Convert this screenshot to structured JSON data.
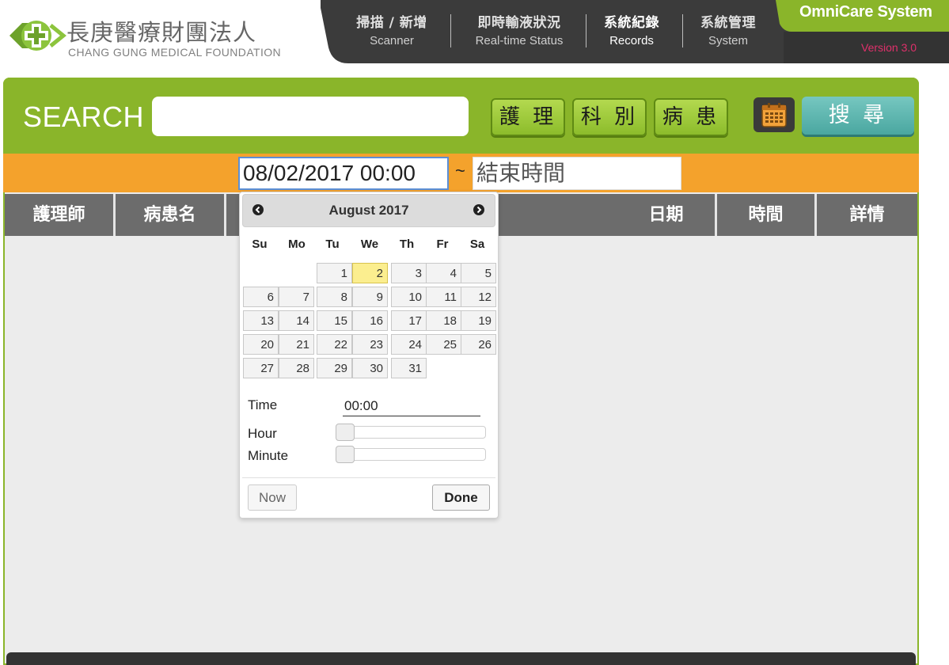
{
  "header": {
    "org_name_zh": "長庚醫療財團法人",
    "org_name_en": "CHANG GUNG MEDICAL FOUNDATION",
    "brand": "OmniCare System",
    "version": "Version 3.0",
    "nav": [
      {
        "zh": "掃描 / 新增",
        "en": "Scanner"
      },
      {
        "zh": "即時輸液狀況",
        "en": "Real-time Status"
      },
      {
        "zh": "系統紀錄",
        "en": "Records"
      },
      {
        "zh": "系統管理",
        "en": "System"
      }
    ],
    "active_nav": "Records"
  },
  "search": {
    "label": "SEARCH",
    "value": "",
    "filters": [
      "護 理",
      "科 別",
      "病 患"
    ],
    "search_button": "搜 尋"
  },
  "date_range": {
    "start": "08/02/2017 00:00",
    "separator": "~",
    "end_placeholder": "結束時間"
  },
  "table": {
    "columns": [
      "護理師",
      "病患名",
      "日期",
      "時間",
      "詳情"
    ]
  },
  "datepicker": {
    "month_title": "August 2017",
    "weekdays": [
      "Su",
      "Mo",
      "Tu",
      "We",
      "Th",
      "Fr",
      "Sa"
    ],
    "days": [
      "1",
      "2",
      "3",
      "4",
      "5",
      "6",
      "7",
      "8",
      "9",
      "10",
      "11",
      "12",
      "13",
      "14",
      "15",
      "16",
      "17",
      "18",
      "19",
      "20",
      "21",
      "22",
      "23",
      "24",
      "25",
      "26",
      "27",
      "28",
      "29",
      "30",
      "31"
    ],
    "selected_day": "2",
    "time_label": "Time",
    "time_value": "00:00",
    "hour_label": "Hour",
    "minute_label": "Minute",
    "hour_level": 0,
    "minute_level": 0,
    "now_button": "Now",
    "done_button": "Done"
  },
  "colors": {
    "accent_green": "#8ab52a",
    "orange_bar": "#f4a22c",
    "teal_button": "#4aa7a0",
    "highlight_day": "#fbee8f",
    "version_pink": "#e0306b"
  }
}
